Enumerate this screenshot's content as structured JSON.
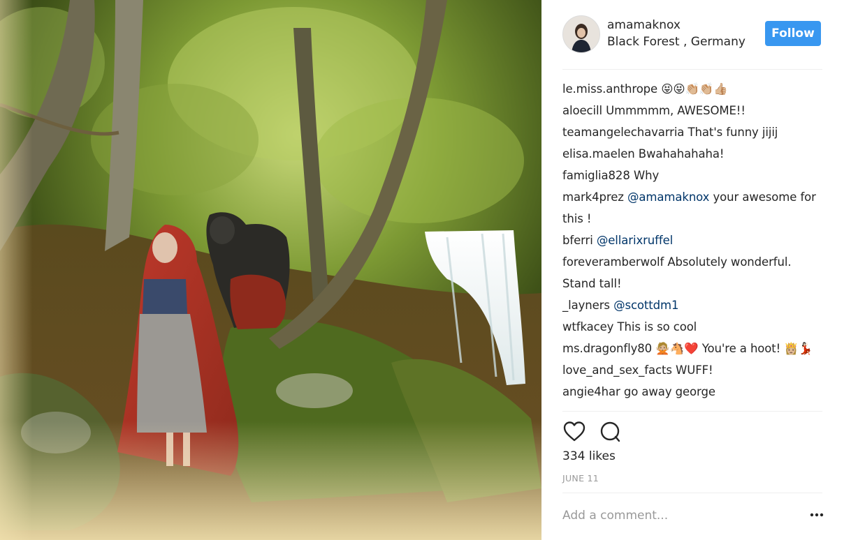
{
  "post": {
    "username": "amamaknox",
    "location": "Black Forest , Germany",
    "follow_label": "Follow",
    "likes": "334 likes",
    "date": "JUNE 11",
    "add_comment_placeholder": "Add a comment...",
    "more_label": "•••"
  },
  "comments": [
    {
      "user": "le.miss.anthrope",
      "text": "😝😝👏🏼👏🏼👍🏼"
    },
    {
      "user": "aloecill",
      "text": "Ummmmm, AWESOME!!"
    },
    {
      "user": "teamangelechavarria",
      "text": "That's funny jijij"
    },
    {
      "user": "elisa.maelen",
      "text": "Bwahahahaha!"
    },
    {
      "user": "famiglia828",
      "text": "Why"
    },
    {
      "user": "mark4prez",
      "mention": "@amamaknox",
      "text": "your awesome for this !"
    },
    {
      "user": "bferri",
      "mention": "@ellarixruffel",
      "text": ""
    },
    {
      "user": "foreveramberwolf",
      "text": "Absolutely wonderful. Stand tall!"
    },
    {
      "user": "_layners",
      "mention": "@scottdm1",
      "text": ""
    },
    {
      "user": "wtfkacey",
      "text": "This is so cool"
    },
    {
      "user": "ms.dragonfly80",
      "text": "🙅🏼🐴❤️ You're a hoot! 👸🏼💃🏻"
    },
    {
      "user": "love_and_sex_facts",
      "text": "WUFF!"
    },
    {
      "user": "angie4har",
      "text": "go away george"
    }
  ],
  "icons": {
    "like": "heart-icon",
    "comment": "comment-bubble-icon",
    "more": "more-options-icon"
  },
  "colors": {
    "follow_button": "#3897f0",
    "mention": "#003569",
    "meta_gray": "#999999"
  }
}
